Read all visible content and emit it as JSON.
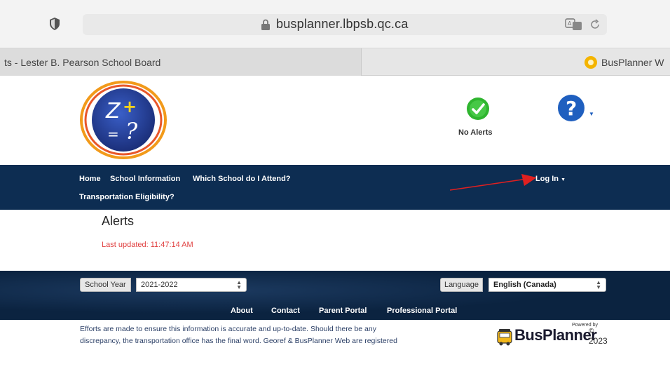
{
  "browser": {
    "url": "busplanner.lbpsb.qc.ca",
    "tabs": [
      {
        "title": "ts - Lester B. Pearson School Board"
      },
      {
        "title": "BusPlanner W"
      }
    ]
  },
  "header": {
    "alerts_status": "No Alerts"
  },
  "nav": {
    "links": [
      "Home",
      "School Information",
      "Which School do I Attend?",
      "Transportation Eligibility?"
    ],
    "login": "Log In"
  },
  "alerts": {
    "title": "Alerts",
    "last_updated_label": "Last updated:",
    "last_updated_time": "11:47:14 AM"
  },
  "footer": {
    "school_year_label": "School Year",
    "school_year_value": "2021-2022",
    "language_label": "Language",
    "language_value": "English (Canada)",
    "links": [
      "About",
      "Contact",
      "Parent Portal",
      "Professional Portal"
    ],
    "disclaimer_line1": "Efforts are made to ensure this information is accurate and up-to-date. Should there be any",
    "disclaimer_line2": "discrepancy, the transportation office has the final word. Georef & BusPlanner Web are registered",
    "brand": "BusPlanner",
    "powered_by": "Powered by",
    "copyright": "©",
    "year": "2023"
  },
  "colors": {
    "nav_bg": "#0d2d52",
    "footer_bg": "#0b2340",
    "alert_red": "#e04040",
    "ok_green": "#2fb52f",
    "help_blue": "#1f5fbf",
    "annotation_arrow": "#e02020"
  }
}
